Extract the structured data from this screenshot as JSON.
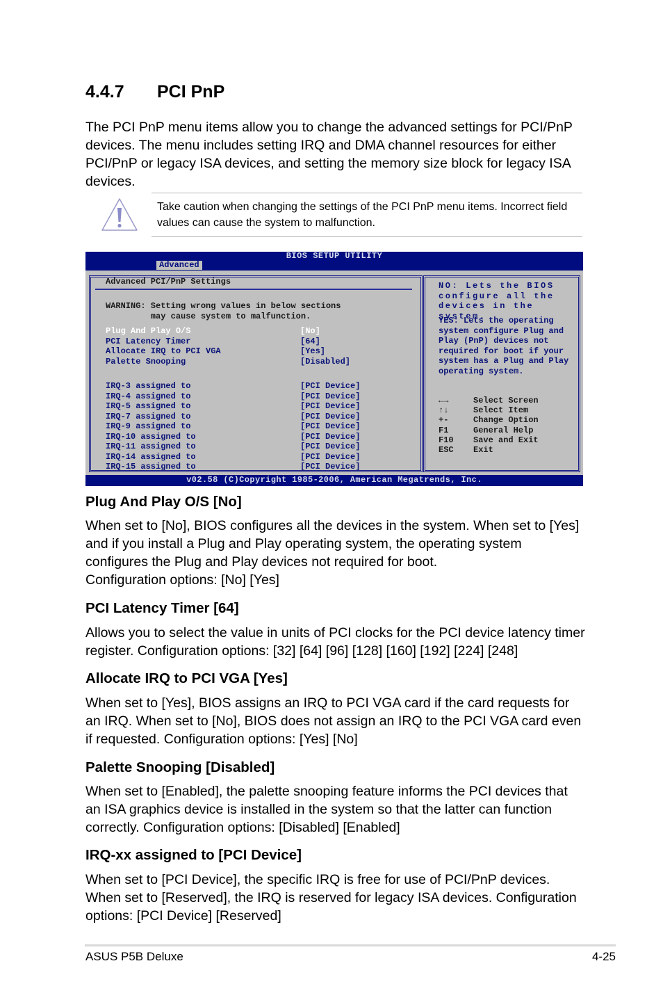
{
  "section": {
    "number": "4.4.7",
    "title": "PCI PnP",
    "intro": "The PCI PnP menu items allow you to change the advanced settings for PCI/PnP devices. The menu includes setting IRQ and DMA channel resources for either PCI/PnP or legacy ISA devices, and setting the memory size block for legacy ISA devices."
  },
  "note": {
    "icon": "caution-triangle-icon",
    "text": "Take caution when changing the settings of the PCI PnP menu items. Incorrect field values can cause the system to malfunction."
  },
  "bios": {
    "title": "BIOS SETUP UTILITY",
    "active_tab": "Advanced",
    "panel_title": "Advanced PCI/PnP Settings",
    "warning_line1": "WARNING: Setting wrong values in below sections",
    "warning_line2": "         may cause system to malfunction.",
    "settings": [
      {
        "label": "Plug And Play O/S",
        "value": "[No]"
      },
      {
        "label": "PCI Latency Timer",
        "value": "[64]"
      },
      {
        "label": "Allocate IRQ to PCI VGA",
        "value": "[Yes]"
      },
      {
        "label": "Palette Snooping",
        "value": "[Disabled]"
      }
    ],
    "irqs": [
      {
        "label": "IRQ-3 assigned to",
        "value": "[PCI Device]"
      },
      {
        "label": "IRQ-4 assigned to",
        "value": "[PCI Device]"
      },
      {
        "label": "IRQ-5 assigned to",
        "value": "[PCI Device]"
      },
      {
        "label": "IRQ-7 assigned to",
        "value": "[PCI Device]"
      },
      {
        "label": "IRQ-9 assigned to",
        "value": "[PCI Device]"
      },
      {
        "label": "IRQ-10 assigned to",
        "value": "[PCI Device]"
      },
      {
        "label": "IRQ-11 assigned to",
        "value": "[PCI Device]"
      },
      {
        "label": "IRQ-14 assigned to",
        "value": "[PCI Device]"
      },
      {
        "label": "IRQ-15 assigned to",
        "value": "[PCI Device]"
      }
    ],
    "help_no": "NO: Lets the BIOS configure all the devices in the system.",
    "help_yes": "YES: Lets the operating system configure Plug and Play (PnP) devices not required for boot if your system has a Plug and Play operating system.",
    "keys": [
      {
        "key": "←→",
        "action": "Select Screen"
      },
      {
        "key": "↑↓",
        "action": "Select Item"
      },
      {
        "key": "+-",
        "action": "Change Option"
      },
      {
        "key": "F1",
        "action": "General Help"
      },
      {
        "key": "F10",
        "action": "Save and Exit"
      },
      {
        "key": "ESC",
        "action": "Exit"
      }
    ],
    "copyright": "v02.58 (C)Copyright 1985-2006, American Megatrends, Inc.",
    "colors": {
      "frame": "#000c80",
      "panel": "#c0c0c0",
      "highlight": "#ffffff",
      "item": "#0a1478"
    }
  },
  "subsections": [
    {
      "title": "Plug And Play O/S [No]",
      "body": "When set to [No], BIOS configures all the devices in the system. When set to [Yes] and if you install a Plug and Play operating system, the operating system configures the Plug and Play devices not required for boot.",
      "options": "Configuration options: [No] [Yes]"
    },
    {
      "title": "PCI Latency Timer [64]",
      "body": "Allows you to select the value in units of PCI clocks for the PCI device latency timer register. Configuration options: [32] [64] [96] [128] [160] [192] [224] [248]"
    },
    {
      "title": "Allocate IRQ to PCI VGA [Yes]",
      "body": "When set to [Yes], BIOS assigns an IRQ to PCI VGA card if the card requests for an IRQ. When set to [No], BIOS does not assign an IRQ to the PCI VGA card even if requested. Configuration options: [Yes] [No]"
    },
    {
      "title": "Palette Snooping [Disabled]",
      "body": "When set to [Enabled], the palette snooping feature informs the PCI devices that an ISA graphics device is installed in the system so that the latter can function correctly. Configuration options: [Disabled] [Enabled]"
    },
    {
      "title": "IRQ-xx assigned to [PCI Device]",
      "body": "When set to [PCI Device], the specific IRQ is free for use of PCI/PnP devices. When set to [Reserved], the IRQ is reserved for legacy ISA devices. Configuration options: [PCI Device] [Reserved]"
    }
  ],
  "footer": {
    "product": "ASUS P5B Deluxe",
    "page": "4-25"
  }
}
